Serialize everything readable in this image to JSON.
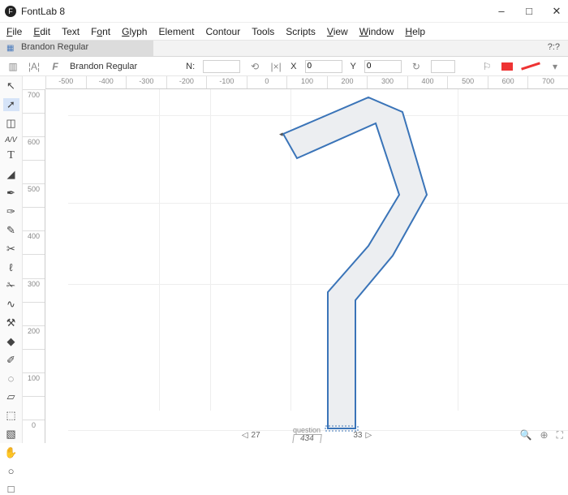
{
  "window": {
    "title": "FontLab 8"
  },
  "menu": {
    "file": "File",
    "edit": "Edit",
    "text": "Text",
    "font": "Font",
    "glyph": "Glyph",
    "element": "Element",
    "contour": "Contour",
    "tools": "Tools",
    "scripts": "Scripts",
    "view": "View",
    "window": "Window",
    "help": "Help"
  },
  "tab": {
    "label": "Brandon Regular",
    "info": "?:?"
  },
  "prop": {
    "font": "Brandon Regular",
    "n_label": "N:",
    "n_value": "",
    "x_label": "X",
    "x_value": "0",
    "y_label": "Y",
    "y_value": "0",
    "angle_value": ""
  },
  "ruler_h": [
    "-500",
    "-400",
    "-300",
    "-200",
    "-100",
    "0",
    "100",
    "200",
    "300",
    "400",
    "500",
    "600",
    "700"
  ],
  "ruler_v": [
    "700",
    "",
    "600",
    "",
    "500",
    "",
    "400",
    "",
    "300",
    "",
    "200",
    "",
    "100",
    "",
    "0"
  ],
  "footer": {
    "left_sb": "27",
    "glyph_name": "question",
    "advance": "434",
    "right_sb": "33"
  },
  "tools": [
    "arrow",
    "contour",
    "element-tool",
    "av",
    "text",
    "eraser",
    "pen",
    "rapid",
    "pencil",
    "knife",
    "brush",
    "scissors",
    "tangent",
    "hammer",
    "fill",
    "pen2",
    "dashed-circle",
    "ruler",
    "rect-sel",
    "guide",
    "hand",
    "ellipse",
    "rect"
  ],
  "icons": {
    "arrow": "▱",
    "contour": "➚",
    "element": "□",
    "av": "AV",
    "text": "T",
    "eraser": "▰",
    "pen": "✒",
    "rapid": "✎",
    "pencil": "✏",
    "knife": "✂",
    "brush": "❧",
    "scissors": "✁",
    "tangent": "∿",
    "hammer": "⚒",
    "fill": "◆",
    "pen2": "✐",
    "dashed": "◌",
    "ruler": "▯",
    "rectsel": "⬚",
    "guide": "▧",
    "hand": "✋",
    "ellipse": "○",
    "rect": "□",
    "min": "–",
    "max": "□",
    "close": "✕",
    "tri_l": "◁",
    "tri_r": "▷",
    "zoomin": "⊕",
    "zoomout": "⊖",
    "fit": "▦"
  }
}
